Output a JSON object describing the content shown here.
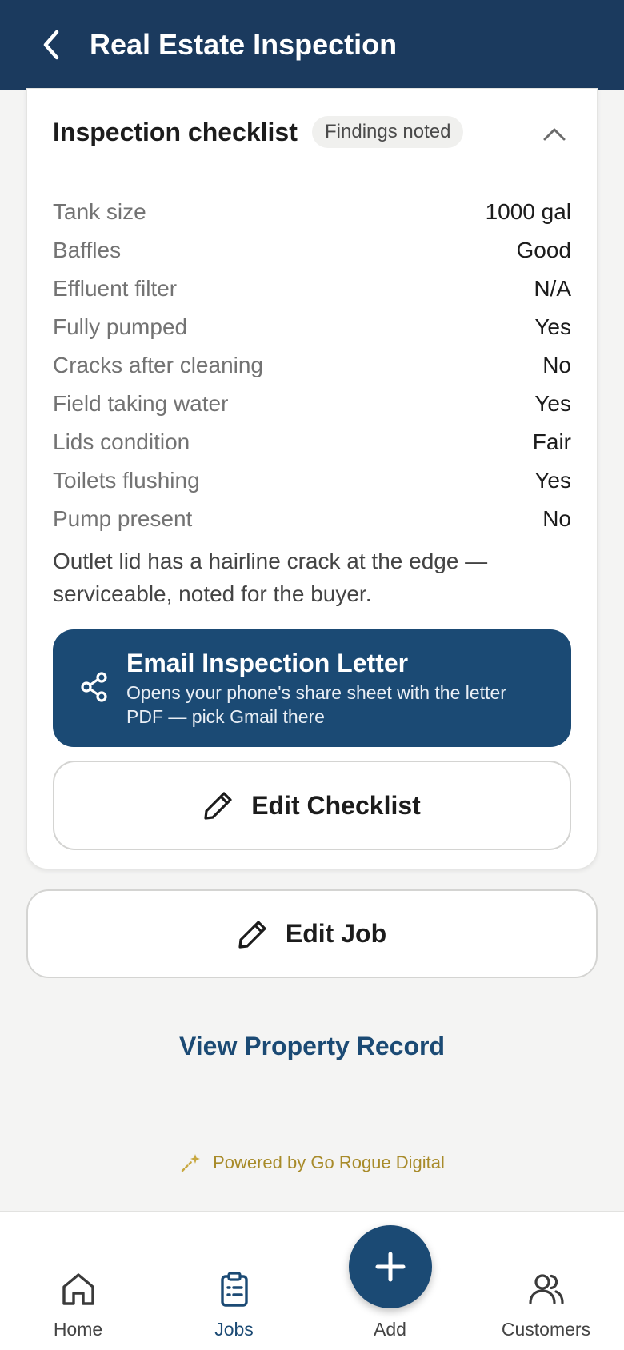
{
  "header": {
    "title": "Real Estate Inspection"
  },
  "card": {
    "title": "Inspection checklist",
    "badge": "Findings noted",
    "rows": [
      {
        "label": "Tank size",
        "value": "1000 gal"
      },
      {
        "label": "Baffles",
        "value": "Good"
      },
      {
        "label": "Effluent filter",
        "value": "N/A"
      },
      {
        "label": "Fully pumped",
        "value": "Yes"
      },
      {
        "label": "Cracks after cleaning",
        "value": "No"
      },
      {
        "label": "Field taking water",
        "value": "Yes"
      },
      {
        "label": "Lids condition",
        "value": "Fair"
      },
      {
        "label": "Toilets flushing",
        "value": "Yes"
      },
      {
        "label": "Pump present",
        "value": "No"
      }
    ],
    "note": "Outlet lid has a hairline crack at the edge — serviceable, noted for the buyer.",
    "email_button": {
      "title": "Email Inspection Letter",
      "subtitle": "Opens your phone's share sheet with the letter PDF — pick Gmail there"
    },
    "edit_checklist_label": "Edit Checklist"
  },
  "edit_job_label": "Edit Job",
  "view_record_label": "View Property Record",
  "powered_by": "Powered by Go Rogue Digital",
  "nav": {
    "home": "Home",
    "jobs": "Jobs",
    "add": "Add",
    "customers": "Customers"
  },
  "colors": {
    "header": "#1b3a5e",
    "primary": "#1b4a74",
    "accent_gold": "#a88b2a"
  }
}
